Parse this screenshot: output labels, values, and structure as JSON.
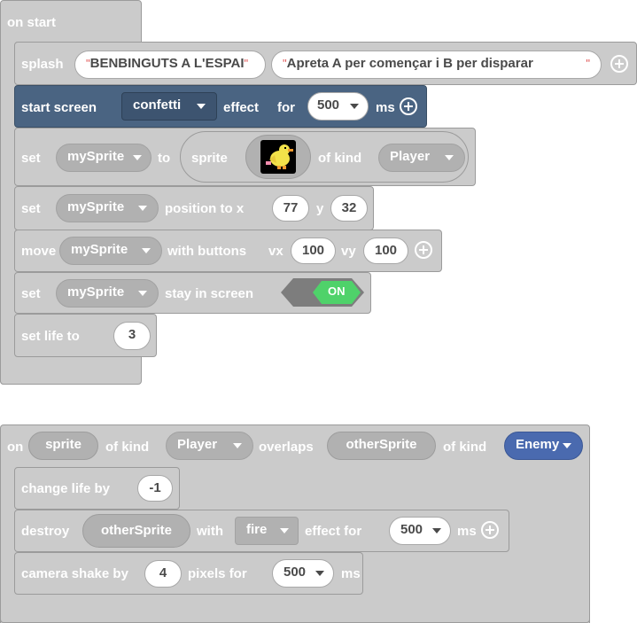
{
  "on_start": {
    "hat_label": "on start",
    "splash": {
      "label": "splash",
      "title": "BENBINGUTS A L'ESPAI",
      "subtitle": "Apreta A per començar i B per disparar",
      "quote_open": "\"",
      "quote_close": "\""
    },
    "start_screen": {
      "label": "start screen",
      "effect_value": "confetti",
      "effect_label": "effect",
      "for_label": "for",
      "duration": "500",
      "unit": "ms"
    },
    "set_sprite": {
      "set_label": "set",
      "variable": "mySprite",
      "to_label": "to",
      "sprite_label": "sprite",
      "of_kind_label": "of kind",
      "kind": "Player",
      "image_icon": "duck-sprite-icon"
    },
    "set_position": {
      "set_label": "set",
      "variable": "mySprite",
      "position_label": "position to x",
      "x": "77",
      "y_label": "y",
      "y": "32"
    },
    "move": {
      "move_label": "move",
      "variable": "mySprite",
      "with_buttons_label": "with buttons",
      "vx_label": "vx",
      "vx": "100",
      "vy_label": "vy",
      "vy": "100"
    },
    "stay_in_screen": {
      "set_label": "set",
      "variable": "mySprite",
      "stay_label": "stay in screen",
      "toggle": "ON"
    },
    "set_life": {
      "label": "set life to",
      "value": "3"
    }
  },
  "overlap": {
    "on_label": "on",
    "sprite_param": "sprite",
    "of_kind_label_1": "of kind",
    "kind_1": "Player",
    "overlaps_label": "overlaps",
    "other_param": "otherSprite",
    "of_kind_label_2": "of kind",
    "kind_2": "Enemy",
    "change_life": {
      "label": "change life by",
      "value": "-1"
    },
    "destroy": {
      "label": "destroy",
      "target": "otherSprite",
      "with_label": "with",
      "effect": "fire",
      "effect_label": "effect for",
      "duration": "500",
      "unit": "ms"
    },
    "camera_shake": {
      "label": "camera shake by",
      "value": "4",
      "pixels_label": "pixels for",
      "duration": "500",
      "unit": "ms"
    }
  },
  "colors": {
    "block_grey": "#cbcbcb",
    "block_blue": "#4a6482",
    "enemy_blue": "#4a6aaf",
    "toggle_green": "#4fd26a"
  }
}
